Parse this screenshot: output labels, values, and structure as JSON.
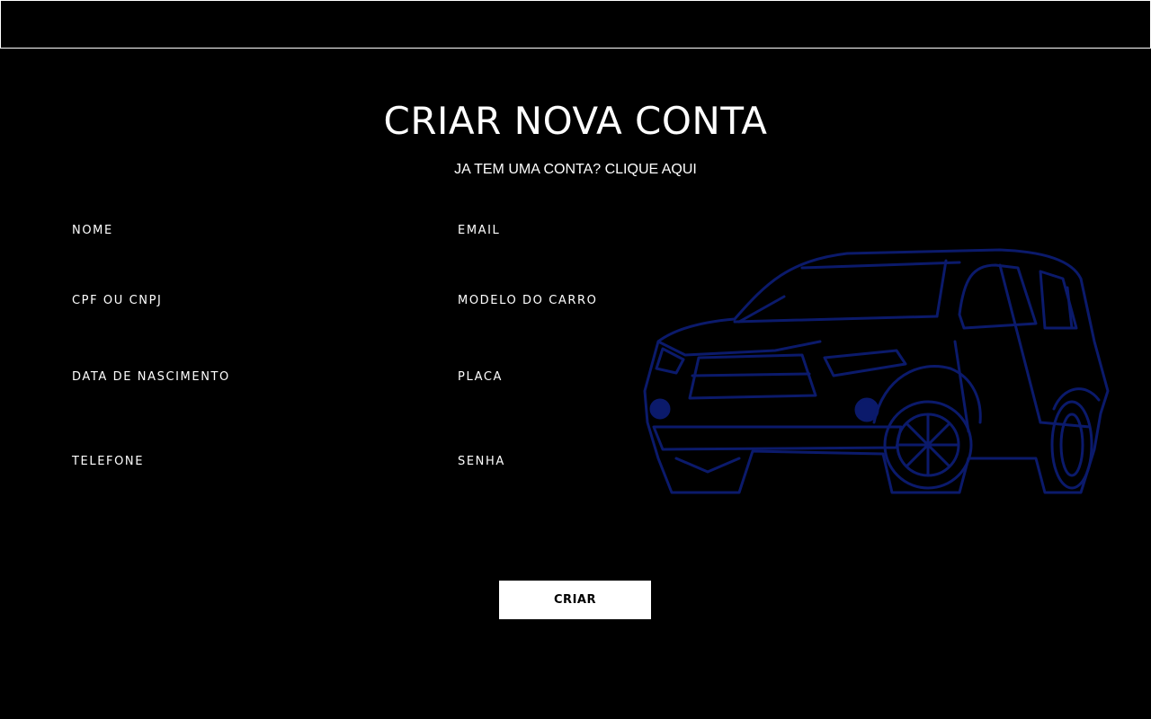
{
  "header": {},
  "form": {
    "title": "CRIAR NOVA CONTA",
    "login_link": "JA TEM UMA CONTA? CLIQUE AQUI",
    "fields": [
      {
        "label": "NOME",
        "value": ""
      },
      {
        "label": "EMAIL",
        "value": ""
      },
      {
        "label": "CPF OU CNPJ",
        "value": ""
      },
      {
        "label": "MODELO DO CARRO",
        "value": ""
      },
      {
        "label": "DATA DE NASCIMENTO",
        "value": ""
      },
      {
        "label": "PLACA",
        "value": ""
      },
      {
        "label": "TELEFONE",
        "value": ""
      },
      {
        "label": "SENHA",
        "value": ""
      }
    ],
    "submit_label": "CRIAR"
  },
  "illustration": {
    "icon": "car-sketch-icon",
    "stroke_color": "#0b1a6b"
  },
  "colors": {
    "background": "#000000",
    "text": "#ffffff",
    "button_bg": "#ffffff",
    "button_text": "#000000"
  }
}
